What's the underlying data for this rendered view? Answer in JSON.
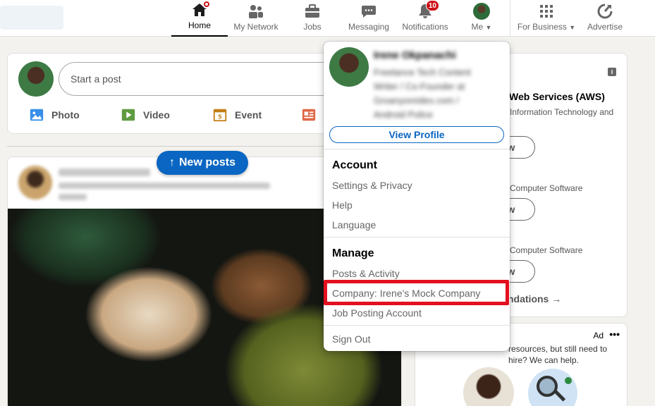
{
  "nav": {
    "items": [
      {
        "label": "Home",
        "icon": "home-icon",
        "active": true
      },
      {
        "label": "My Network",
        "icon": "network-icon"
      },
      {
        "label": "Jobs",
        "icon": "briefcase-icon"
      },
      {
        "label": "Messaging",
        "icon": "messaging-icon"
      },
      {
        "label": "Notifications",
        "icon": "bell-icon",
        "badge": "10"
      },
      {
        "label": "Me",
        "icon": "avatar"
      },
      {
        "label": "For Business",
        "icon": "grid-icon"
      },
      {
        "label": "Advertise",
        "icon": "advertise-icon"
      }
    ]
  },
  "share": {
    "placeholder": "Start a post",
    "actions": [
      {
        "label": "Photo",
        "color": "#378fe9"
      },
      {
        "label": "Video",
        "color": "#5f9b41"
      },
      {
        "label": "Event",
        "color": "#c37d16"
      }
    ]
  },
  "feed": {
    "new_posts": "New posts"
  },
  "right": {
    "company_title": "Web Services (AWS)",
    "company_sub": "Information Technology and",
    "follow_label": "ow",
    "sub2": "Computer Software",
    "sub3": "Computer Software",
    "recommendations": "ndations",
    "ad_label": "Ad",
    "ad_text": "resources, but still need to hire? We can help."
  },
  "dropdown": {
    "name": "Irene Okpanachi",
    "headline": "Freelance Tech Content Writer / Co-Founder at Groanyonridex.com / Android Police",
    "view_profile": "View Profile",
    "account_heading": "Account",
    "account_items": [
      "Settings & Privacy",
      "Help",
      "Language"
    ],
    "manage_heading": "Manage",
    "manage_items": [
      "Posts & Activity",
      "Company: Irene's Mock Company",
      "Job Posting Account"
    ],
    "sign_out": "Sign Out"
  },
  "colors": {
    "accent": "#0a66c2",
    "badge": "#cc1016",
    "highlight": "#e3101e"
  }
}
